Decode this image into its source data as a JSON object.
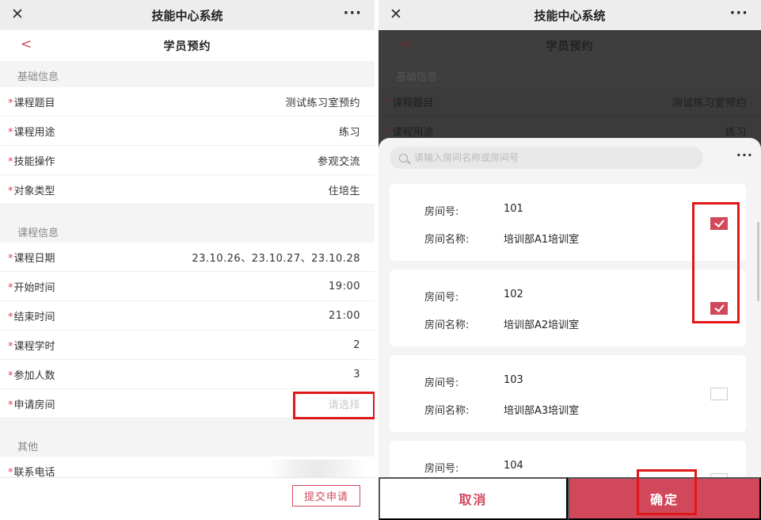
{
  "app_title": "技能中心系统",
  "menu_icon_text": "···",
  "close_icon_text": "✕",
  "back_icon_text": "<",
  "page_title": "学员预约",
  "required_mark": "*",
  "colors": {
    "accent": "#d2485b",
    "highlight": "#e01818"
  },
  "left": {
    "sections": {
      "basic": "基础信息",
      "course": "课程信息",
      "other": "其他"
    },
    "rows": [
      {
        "label": "课程题目",
        "value": "测试练习室预约"
      },
      {
        "label": "课程用途",
        "value": "练习"
      },
      {
        "label": "技能操作",
        "value": "参观交流"
      },
      {
        "label": "对象类型",
        "value": "住培生"
      },
      {
        "label": "课程日期",
        "value": "23.10.26、23.10.27、23.10.28"
      },
      {
        "label": "开始时间",
        "value": "19:00"
      },
      {
        "label": "结束时间",
        "value": "21:00"
      },
      {
        "label": "课程学时",
        "value": "2"
      },
      {
        "label": "参加人数",
        "value": "3"
      },
      {
        "label": "申请房间",
        "placeholder": "请选择"
      },
      {
        "label": "联系电话",
        "value": ""
      }
    ],
    "submit_label": "提交申请"
  },
  "right": {
    "sections": {
      "basic": "基础信息"
    },
    "rows": [
      {
        "label": "课程题目",
        "value": "测试练习室预约"
      },
      {
        "label": "课程用途",
        "value": "练习"
      }
    ],
    "search_placeholder": "请输入房间名称或房间号",
    "room_no_label": "房间号:",
    "room_name_label": "房间名称:",
    "rooms": [
      {
        "no": "101",
        "name": "培训部A1培训室",
        "checked": true
      },
      {
        "no": "102",
        "name": "培训部A2培训室",
        "checked": true
      },
      {
        "no": "103",
        "name": "培训部A3培训室",
        "checked": false
      },
      {
        "no": "104",
        "name": "",
        "checked": false
      }
    ],
    "cancel_label": "取消",
    "confirm_label": "确定"
  }
}
